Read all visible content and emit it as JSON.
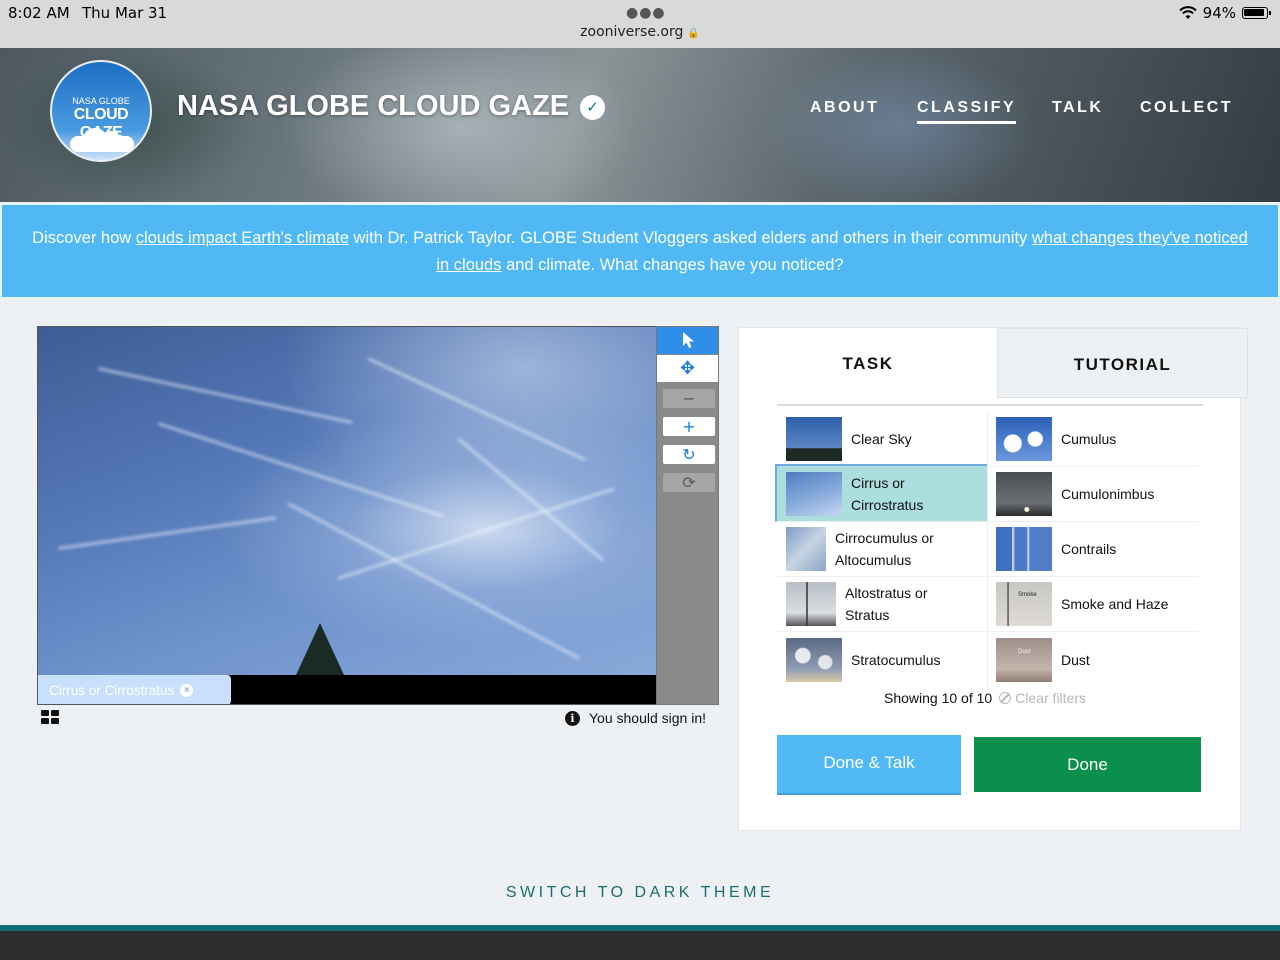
{
  "status_bar": {
    "time": "8:02 AM",
    "date": "Thu Mar 31",
    "url": "zooniverse.org",
    "battery": "94%",
    "icons": [
      "wifi-icon",
      "lock-icon",
      "battery-icon"
    ]
  },
  "header": {
    "logo": {
      "line1": "NASA GLOBE",
      "line2": "CLOUD GAZE"
    },
    "title": "NASA GLOBE CLOUD GAZE",
    "nav": [
      {
        "label": "ABOUT",
        "active": false
      },
      {
        "label": "CLASSIFY",
        "active": true
      },
      {
        "label": "TALK",
        "active": false
      },
      {
        "label": "COLLECT",
        "active": false
      }
    ]
  },
  "announcement": {
    "part1": "Discover how ",
    "link1": "clouds impact Earth's climate",
    "part2": " with Dr. Patrick Taylor. GLOBE Student Vloggers asked elders and others in their community ",
    "link2": "what changes they've noticed in clouds",
    "part3": " and climate. What changes have you noticed?"
  },
  "viewer": {
    "chip_label": "Cirrus or Cirrostratus",
    "tools": [
      "pointer-icon",
      "move-icon",
      "zoom-out-icon",
      "zoom-in-icon",
      "rotate-icon",
      "reset-icon"
    ],
    "sign_in_text": "You should sign in!"
  },
  "task_panel": {
    "tabs": [
      {
        "label": "TASK",
        "active": true
      },
      {
        "label": "TUTORIAL",
        "active": false
      }
    ],
    "choices": [
      {
        "label": "Clear Sky",
        "selected": false
      },
      {
        "label": "Cumulus",
        "selected": false
      },
      {
        "label": "Cirrus or Cirrostratus",
        "selected": true
      },
      {
        "label": "Cumulonimbus",
        "selected": false
      },
      {
        "label": "Cirrocumulus or Altocumulus",
        "selected": false
      },
      {
        "label": "Contrails",
        "selected": false
      },
      {
        "label": "Altostratus or Stratus",
        "selected": false
      },
      {
        "label": "Smoke and Haze",
        "selected": false
      },
      {
        "label": "Stratocumulus",
        "selected": false
      },
      {
        "label": "Dust",
        "selected": false
      }
    ],
    "thumb_captions": {
      "smoke": "Smoke",
      "dust": "Dust"
    },
    "showing": "Showing 10 of 10",
    "clear_filters": "Clear filters",
    "done_talk": "Done & Talk",
    "done": "Done"
  },
  "footer": {
    "dark_theme": "SWITCH TO DARK THEME"
  },
  "colors": {
    "accent_blue": "#4fb8f5",
    "done_green": "#0a8f4c",
    "selected_choice": "#acdddf",
    "teal_text": "#1b6c75"
  }
}
